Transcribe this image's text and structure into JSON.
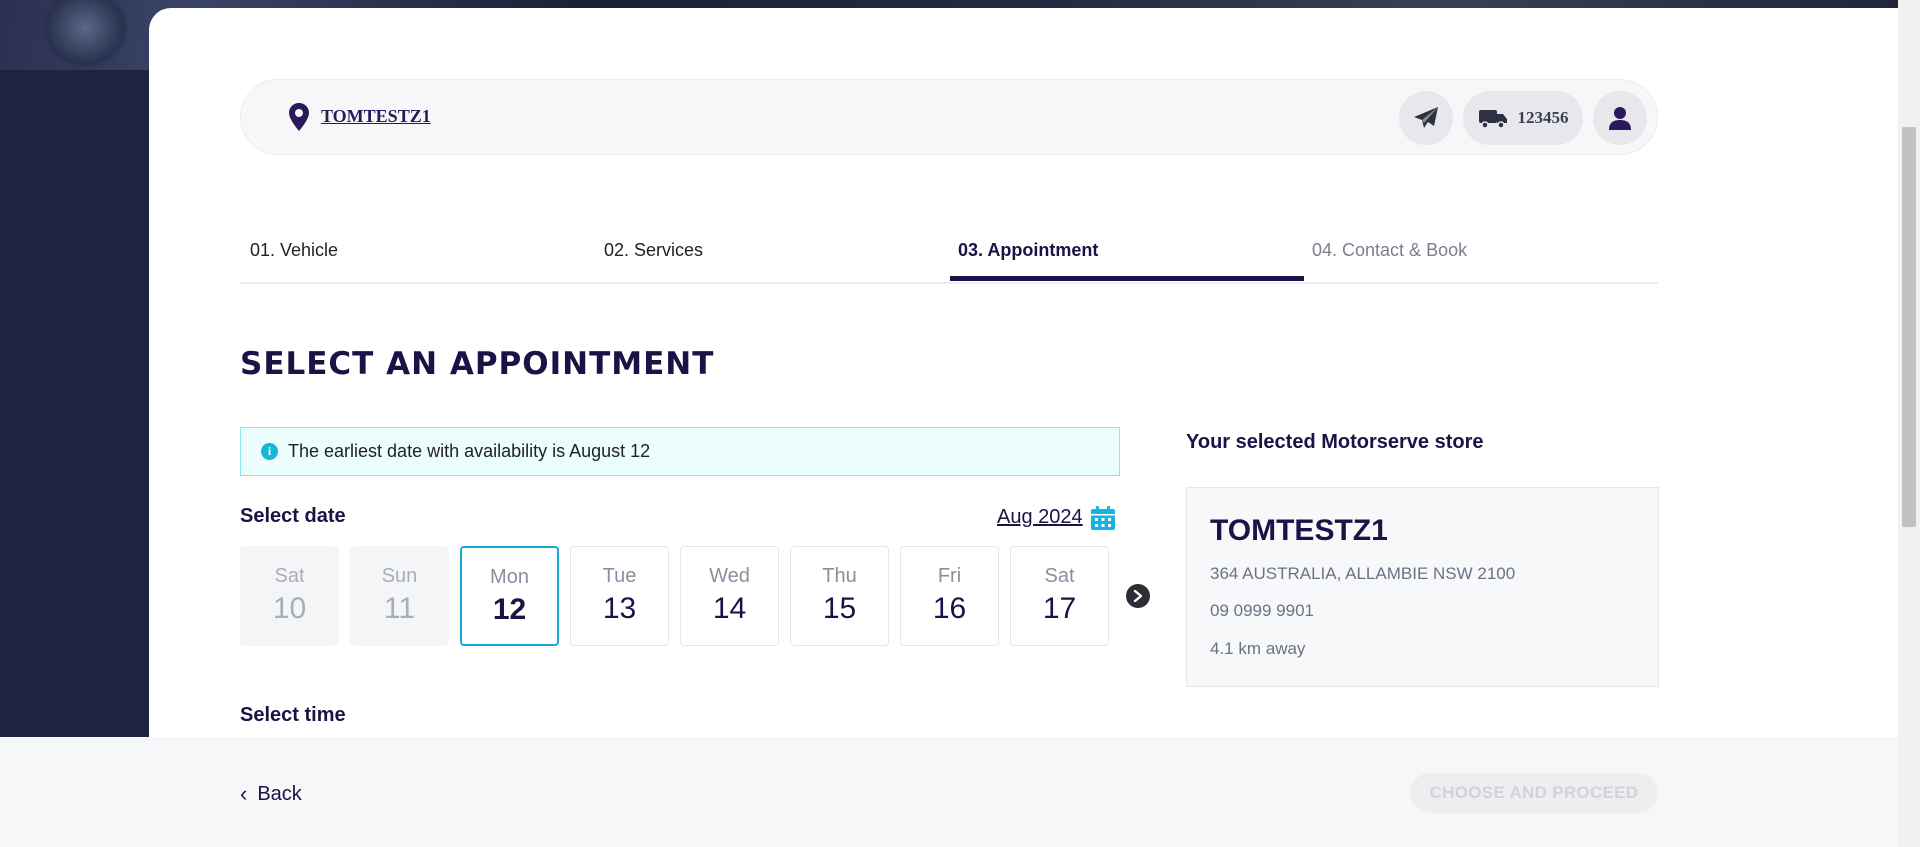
{
  "header": {
    "location_name": "TOMTESTZ1",
    "rego": "123456"
  },
  "steps": [
    {
      "label": "01. Vehicle"
    },
    {
      "label": "02. Services"
    },
    {
      "label": "03. Appointment",
      "active": true
    },
    {
      "label": "04. Contact & Book"
    }
  ],
  "page_title": "SELECT AN APPOINTMENT",
  "notice": {
    "text": "The earliest date with availability is August 12"
  },
  "date_picker": {
    "label": "Select date",
    "month": "Aug 2024",
    "days": [
      {
        "dow": "Sat",
        "num": "10",
        "state": "disabled"
      },
      {
        "dow": "Sun",
        "num": "11",
        "state": "disabled"
      },
      {
        "dow": "Mon",
        "num": "12",
        "state": "selected"
      },
      {
        "dow": "Tue",
        "num": "13",
        "state": "available"
      },
      {
        "dow": "Wed",
        "num": "14",
        "state": "available"
      },
      {
        "dow": "Thu",
        "num": "15",
        "state": "available"
      },
      {
        "dow": "Fri",
        "num": "16",
        "state": "available"
      },
      {
        "dow": "Sat",
        "num": "17",
        "state": "available"
      }
    ]
  },
  "time_picker": {
    "label": "Select time"
  },
  "store": {
    "heading": "Your selected Motorserve store",
    "name": "TOMTESTZ1",
    "address": "364 AUSTRALIA, ALLAMBIE NSW 2100",
    "phone": "09 0999 9901",
    "distance": "4.1 km away"
  },
  "footer": {
    "back_label": "Back",
    "proceed_label": "CHOOSE AND PROCEED"
  },
  "colors": {
    "brand_navy": "#1a1446",
    "selected_border": "#18a8d8",
    "info_cyan": "#14b8d4"
  }
}
